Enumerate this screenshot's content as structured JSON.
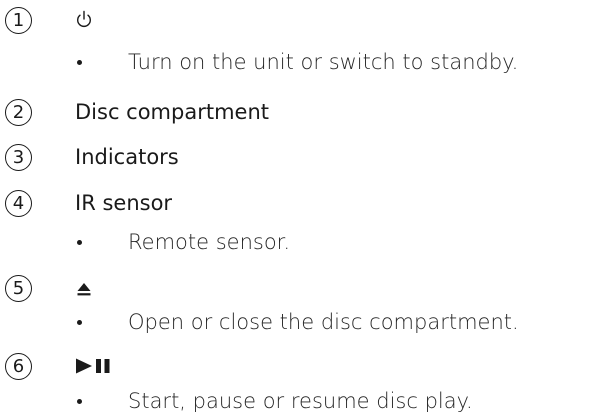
{
  "items": [
    {
      "number": "1",
      "icon": "power-icon",
      "description": "Turn on the unit or switch to standby."
    },
    {
      "number": "2",
      "title": "Disc compartment"
    },
    {
      "number": "3",
      "title": "Indicators"
    },
    {
      "number": "4",
      "title": "IR sensor",
      "description": "Remote sensor."
    },
    {
      "number": "5",
      "icon": "eject-icon",
      "description": "Open or close the disc compartment."
    },
    {
      "number": "6",
      "icon": "play-pause-icon",
      "description": "Start, pause or resume disc play."
    }
  ]
}
